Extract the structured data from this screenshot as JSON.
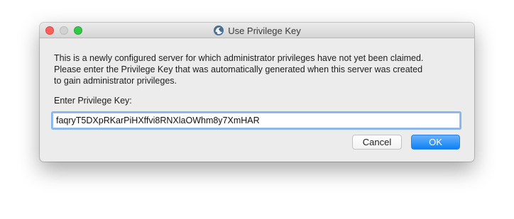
{
  "window": {
    "title": "Use Privilege Key",
    "app_icon": "teamspeak-icon"
  },
  "message": {
    "text": "This is a newly configured server for which administrator privileges have not yet been claimed.\nPlease enter the Privilege Key that was automatically generated when this server was created\nto gain administrator privileges."
  },
  "privilege_key": {
    "label": "Enter Privilege Key:",
    "value": "faqryT5DXpRKarPiHXffvi8RNXlaOWhm8y7XmHAR"
  },
  "buttons": {
    "cancel_label": "Cancel",
    "ok_label": "OK"
  },
  "colors": {
    "close": "#fc605b",
    "minimize": "#d2d2d2",
    "zoom": "#34c84a",
    "accent": "#0d81f7",
    "focus_ring": "#85b4ee"
  }
}
